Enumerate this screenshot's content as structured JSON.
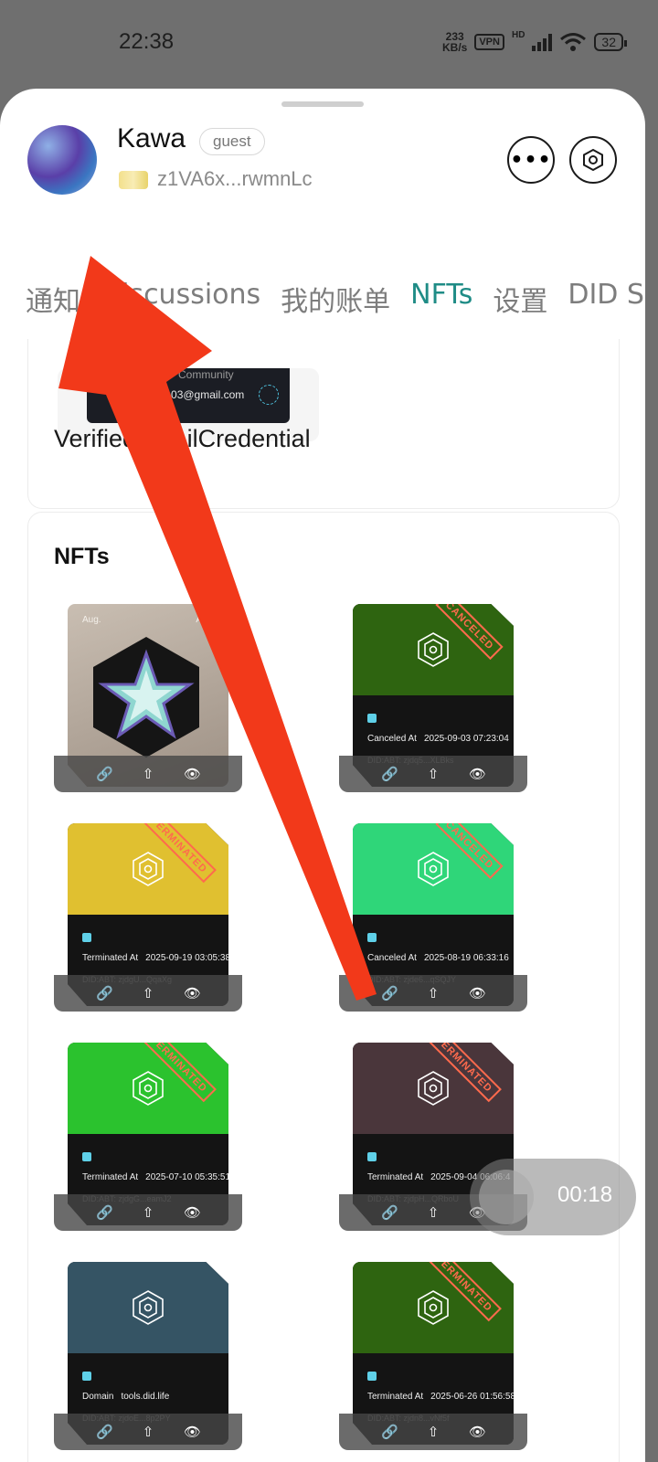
{
  "status_bar": {
    "time": "22:38",
    "net_speed_top": "233",
    "net_speed_bottom": "KB/s",
    "vpn": "VPN",
    "hd": "HD",
    "battery": "32"
  },
  "profile": {
    "name": "Kawa",
    "role": "guest",
    "address": "z1VA6x...rwmnLc"
  },
  "tabs": [
    "通知",
    "Discussions",
    "我的账单",
    "NFTs",
    "设置",
    "DID S"
  ],
  "active_tab": "NFTs",
  "credential": {
    "thumb_line1": "Community",
    "thumb_line2": "aolin103@gmail.com",
    "title": "VerifiedEmailCredential"
  },
  "nfts_section": {
    "heading": "NFTs",
    "items": [
      {
        "kind": "aug",
        "label_left": "Aug.",
        "label_right": "AMA",
        "color": "#9e9185"
      },
      {
        "kind": "status",
        "color": "#2e6410",
        "stamp": "CANCELED",
        "label": "Canceled At",
        "value": "2025-09-03 07:23:04",
        "did_prefix": "DID:ABT:",
        "did": "zjdq5...XLBks"
      },
      {
        "kind": "status",
        "color": "#e0c030",
        "stamp": "TERMINATED",
        "label": "Terminated At",
        "value": "2025-09-19 03:05:38",
        "did_prefix": "DID:ABT:",
        "did": "zjdgU...QqaXg"
      },
      {
        "kind": "status",
        "color": "#2fd679",
        "stamp": "CANCELED",
        "label": "Canceled At",
        "value": "2025-08-19 06:33:16",
        "did_prefix": "DID:ABT:",
        "did": "zjde6...qSQJY"
      },
      {
        "kind": "status",
        "color": "#2bc22e",
        "stamp": "TERMINATED",
        "label": "Terminated At",
        "value": "2025-07-10 05:35:51",
        "did_prefix": "DID:ABT:",
        "did": "zjdgG...eamJ2"
      },
      {
        "kind": "status",
        "color": "#4a363b",
        "stamp": "TERMINATED",
        "label": "Terminated At",
        "value": "2025-09-04 06:06:4",
        "did_prefix": "DID:ABT:",
        "did": "zjdpH...QRboU"
      },
      {
        "kind": "status",
        "color": "#355464",
        "stamp": "",
        "label": "Domain",
        "value": "tools.did.life",
        "did_prefix": "DID:ABT:",
        "did": "zjdoE...8p2PY"
      },
      {
        "kind": "status",
        "color": "#2e6410",
        "stamp": "TERMINATED",
        "label": "Terminated At",
        "value": "2025-06-26 01:56:58",
        "did_prefix": "DID:ABT:",
        "did": "zjdn8...vNf5f"
      }
    ]
  },
  "recording": {
    "time": "00:18"
  },
  "annotation": {
    "arrow_color": "#f2391a"
  }
}
